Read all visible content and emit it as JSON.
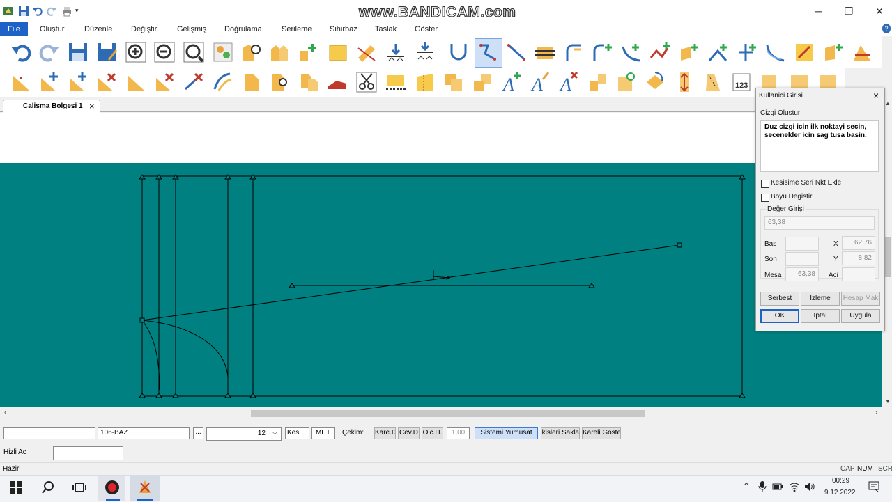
{
  "watermark": "www.BANDICAM.com",
  "menu": [
    "File",
    "Oluştur",
    "Düzenle",
    "Değiştir",
    "Gelişmiş",
    "Doğrulama",
    "Serileme",
    "Sihirbaz",
    "Taslak",
    "Göster"
  ],
  "tab": {
    "label": "Calisma Bolgesi 1",
    "close": "×"
  },
  "dialog": {
    "title": "Kullanici Girisi",
    "close": "×",
    "subtitle": "Cizgi Olustur",
    "instructions": "Duz cizgi icin ilk noktayi secin, secenekler icin sag tusa basin.",
    "check1": "Kesisime Seri Nkt Ekle",
    "check2": "Boyu Degistir",
    "value_label": "Değer Girişi",
    "value": "63,38",
    "bas_label": "Bas",
    "son_label": "Son",
    "mesafe_label": "Mesa",
    "mesafe_value": "63,38",
    "x_label": "X",
    "x_value": "62,76",
    "y_label": "Y",
    "y_value": "8,82",
    "aci_label": "Aci",
    "btn_serbest": "Serbest",
    "btn_izleme": "Izleme",
    "btn_hesap": "Hesap Mak",
    "btn_ok": "OK",
    "btn_iptal": "Iptal",
    "btn_uygula": "Uygula"
  },
  "statusbar": {
    "field_blank": "",
    "field_piece": "106-BAZ",
    "ellipsis": "...",
    "size_value": "12",
    "kes": "Kes",
    "met": "MET",
    "cekim_label": "Çekim:",
    "btn_kare": "Kare.D",
    "btn_cev": "Cev.D",
    "btn_olc": "Olc.H.",
    "num_value": "1,00",
    "btn_sistemi": "Sistemi Yumusat",
    "btn_dikis": "Dikisleri Sakla",
    "btn_kareli": "Kareli Goster",
    "hizli_label": "Hizli Ac",
    "hizli_value": "",
    "status": "Hazir",
    "ind_cap": "CAP",
    "ind_num": "NUM",
    "ind_scr": "SCR"
  },
  "taskbar": {
    "time": "00:29",
    "date": "9.12.2022"
  },
  "colors": {
    "canvas": "#008080",
    "menu_file": "#1e62c8",
    "line": "#000000"
  }
}
